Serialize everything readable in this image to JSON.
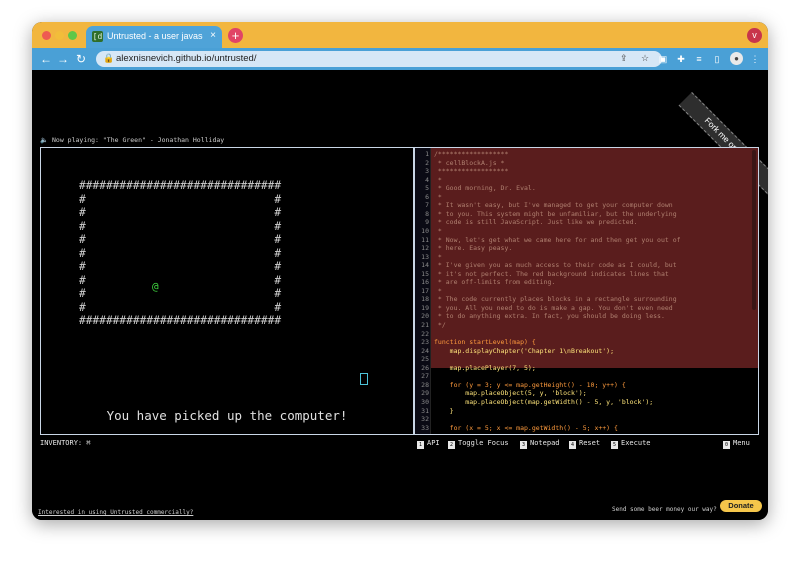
{
  "browser": {
    "tab_title": "Untrusted - a user javasc",
    "tab_favicon": "[d",
    "tab_close": "×",
    "new_tab": "+",
    "url": "alexnisnevich.github.io/untrusted/",
    "profile_icon": "v"
  },
  "page": {
    "ribbon": "Fork me on GitHub",
    "now_playing": "🔈 Now playing: \"The Green\" - Jonathan Holliday",
    "status_message": "You have picked up the computer!",
    "inventory_label": "INVENTORY: ⌘",
    "commands": [
      {
        "key": "1",
        "label": "API"
      },
      {
        "key": "2",
        "label": "Toggle Focus"
      },
      {
        "key": "3",
        "label": "Notepad"
      },
      {
        "key": "4",
        "label": "Reset"
      },
      {
        "key": "5",
        "label": "Execute"
      },
      {
        "key": "0",
        "label": "Menu"
      }
    ],
    "footer_link": "Interested in using Untrusted commercially?",
    "beer_text": "Send some beer money our way?",
    "donate_label": "Donate"
  },
  "game_map": {
    "rows": [
      "##############################",
      "#                            #",
      "#                            #",
      "#                            #",
      "#                            #",
      "#                            #",
      "#                            #",
      "#                            #",
      "#                            #",
      "#                            #",
      "##############################"
    ],
    "player_symbol": "@"
  },
  "editor": {
    "lines": [
      {
        "n": "1",
        "t": "/******************",
        "c": "cm"
      },
      {
        "n": "2",
        "t": " * cellBlockA.js *",
        "c": "cm"
      },
      {
        "n": "3",
        "t": " ******************",
        "c": "cm"
      },
      {
        "n": "4",
        "t": " *",
        "c": "cm"
      },
      {
        "n": "5",
        "t": " * Good morning, Dr. Eval.",
        "c": "cm"
      },
      {
        "n": "6",
        "t": " *",
        "c": "cm"
      },
      {
        "n": "7",
        "t": " * It wasn't easy, but I've managed to get your computer down",
        "c": "cm"
      },
      {
        "n": "8",
        "t": " * to you. This system might be unfamiliar, but the underlying",
        "c": "cm"
      },
      {
        "n": "9",
        "t": " * code is still JavaScript. Just like we predicted.",
        "c": "cm"
      },
      {
        "n": "10",
        "t": " *",
        "c": "cm"
      },
      {
        "n": "11",
        "t": " * Now, let's get what we came here for and then get you out of",
        "c": "cm"
      },
      {
        "n": "12",
        "t": " * here. Easy peasy.",
        "c": "cm"
      },
      {
        "n": "13",
        "t": " *",
        "c": "cm"
      },
      {
        "n": "14",
        "t": " * I've given you as much access to their code as I could, but",
        "c": "cm"
      },
      {
        "n": "15",
        "t": " * it's not perfect. The red background indicates lines that",
        "c": "cm"
      },
      {
        "n": "16",
        "t": " * are off-limits from editing.",
        "c": "cm"
      },
      {
        "n": "17",
        "t": " *",
        "c": "cm"
      },
      {
        "n": "18",
        "t": " * The code currently places blocks in a rectangle surrounding",
        "c": "cm"
      },
      {
        "n": "19",
        "t": " * you. All you need to do is make a gap. You don't even need",
        "c": "cm"
      },
      {
        "n": "20",
        "t": " * to do anything extra. In fact, you should be doing less.",
        "c": "cm"
      },
      {
        "n": "21",
        "t": " */",
        "c": "cm"
      },
      {
        "n": "22",
        "t": "",
        "c": "tx"
      },
      {
        "n": "23",
        "t": "function startLevel(map) {",
        "c": "kw"
      },
      {
        "n": "24",
        "t": "    map.displayChapter('Chapter 1\\nBreakout');",
        "c": "tx"
      },
      {
        "n": "25",
        "t": "",
        "c": "tx"
      },
      {
        "n": "26",
        "t": "    map.placePlayer(7, 5);",
        "c": "tx"
      },
      {
        "n": "27",
        "t": "",
        "c": "tx"
      },
      {
        "n": "28",
        "t": "    for (y = 3; y <= map.getHeight() - 10; y++) {",
        "c": "kw"
      },
      {
        "n": "29",
        "t": "        map.placeObject(5, y, 'block');",
        "c": "tx"
      },
      {
        "n": "30",
        "t": "        map.placeObject(map.getWidth() - 5, y, 'block');",
        "c": "tx"
      },
      {
        "n": "31",
        "t": "    }",
        "c": "tx"
      },
      {
        "n": "32",
        "t": "",
        "c": "tx"
      },
      {
        "n": "33",
        "t": "    for (x = 5; x <= map.getWidth() - 5; x++) {",
        "c": "kw"
      }
    ]
  },
  "colors": {
    "tab_bar": "#f2b63f",
    "toolbar": "#4aa0d6",
    "editor_locked_bg": "#5a1d1d",
    "player": "#3fd33f",
    "donate": "#f5c64b"
  }
}
